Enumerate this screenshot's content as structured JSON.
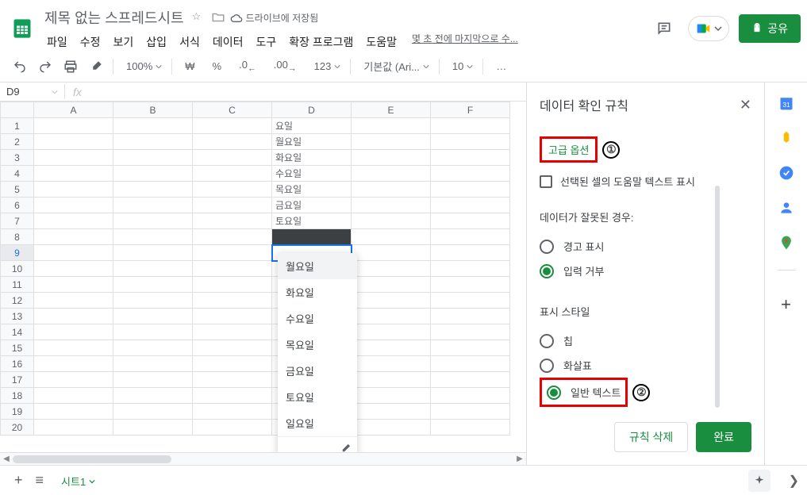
{
  "doc": {
    "title": "제목 없는 스프레드시트",
    "cloud": "드라이브에 저장됨",
    "last_edit": "몇 초 전에 마지막으로 수..."
  },
  "menus": [
    "파일",
    "수정",
    "보기",
    "삽입",
    "서식",
    "데이터",
    "도구",
    "확장 프로그램",
    "도움말"
  ],
  "share": "공유",
  "toolbar": {
    "zoom": "100%",
    "currency": "₩",
    "percent": "%",
    "fmt1": ".0",
    "fmt2": ".00",
    "num": "123",
    "font": "기본값 (Ari...",
    "size": "10",
    "more": "…"
  },
  "namebox": "D9",
  "cols": [
    "A",
    "B",
    "C",
    "D",
    "E",
    "F"
  ],
  "cells": {
    "d1": "요일",
    "d2": "월요일",
    "d3": "화요일",
    "d4": "수요일",
    "d5": "목요일",
    "d6": "금요일",
    "d7": "토요일"
  },
  "rows": 20,
  "dropdown": [
    "월요일",
    "화요일",
    "수요일",
    "목요일",
    "금요일",
    "토요일",
    "일요일"
  ],
  "panel": {
    "title": "데이터 확인 규칙",
    "adv": "고급 옵션",
    "help_checkbox": "선택된 셀의 도움말 텍스트 표시",
    "invalid_label": "데이터가 잘못된 경우:",
    "invalid_warn": "경고 표시",
    "invalid_reject": "입력 거부",
    "style_label": "표시 스타일",
    "style_chip": "칩",
    "style_arrow": "화살표",
    "style_plain": "일반 텍스트",
    "delete": "규칙 삭제",
    "done": "완료",
    "badge1": "①",
    "badge2": "②"
  },
  "sheet": {
    "tab": "시트1"
  }
}
